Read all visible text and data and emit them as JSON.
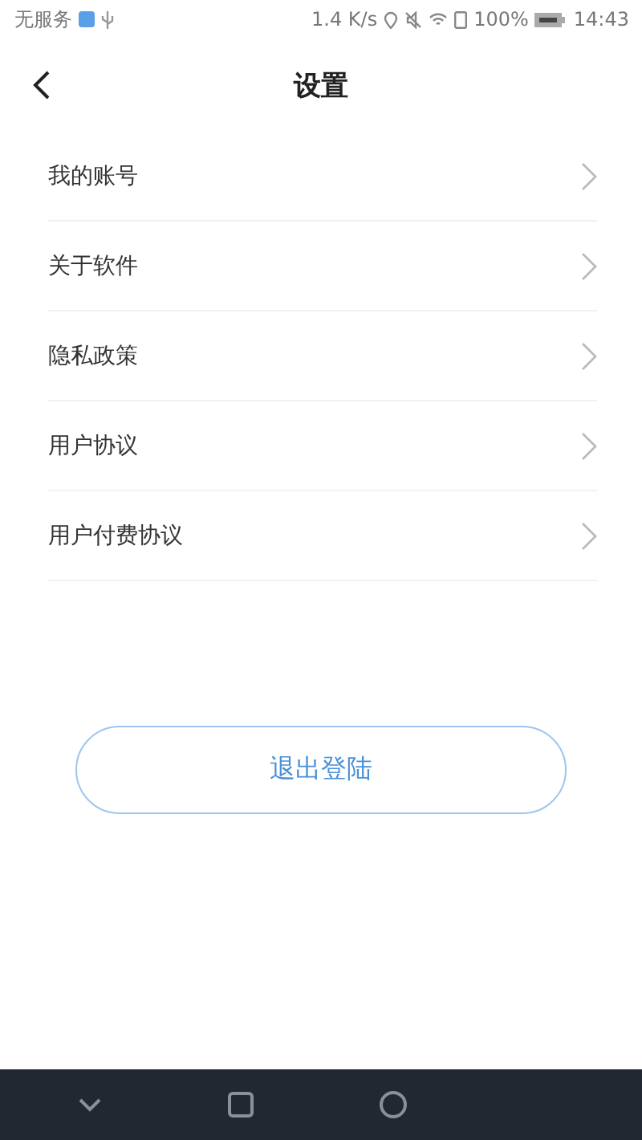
{
  "status_bar": {
    "carrier": "无服务",
    "speed": "1.4 K/s",
    "battery": "100%",
    "time": "14:43"
  },
  "header": {
    "title": "设置"
  },
  "menu": [
    {
      "label": "我的账号"
    },
    {
      "label": "关于软件"
    },
    {
      "label": "隐私政策"
    },
    {
      "label": "用户协议"
    },
    {
      "label": "用户付费协议"
    }
  ],
  "logout_button": {
    "label": "退出登陆"
  }
}
